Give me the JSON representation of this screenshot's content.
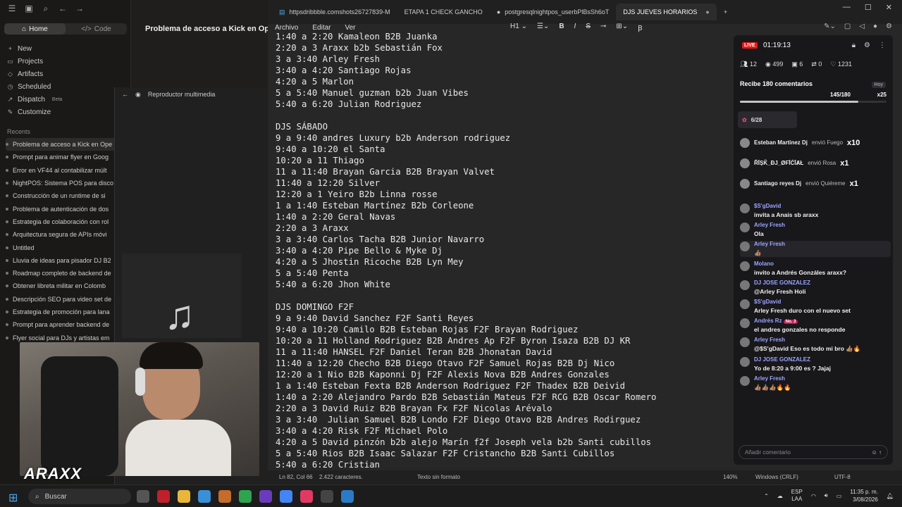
{
  "app_left": {
    "nav_tabs": [
      "Home",
      "Code"
    ],
    "nav": [
      "New",
      "Projects",
      "Artifacts",
      "Scheduled",
      "Dispatch",
      "Customize"
    ],
    "dispatch_badge": "Beta",
    "recents_title": "Recents",
    "recents": [
      "Problema de acceso a Kick en Ope",
      "Prompt para animar flyer en Goog",
      "Error en VF44 al contabilizar múlt",
      "NightPOS: Sistema POS para disco",
      "Construcción de un runtime de si",
      "Problema de autenticación de dos",
      "Estrategia de colaboración con rol",
      "Arquitectura segura de APIs móvi",
      "Untitled",
      "Lluvia de ideas para pisador DJ B2",
      "Roadmap completo de backend de",
      "Obtener libreta militar en Colomb",
      "Descripción SEO para video set de",
      "Estrategia de promoción para lana",
      "Prompt para aprender backend de",
      "Flyer social para DJs y artistas em"
    ],
    "chat_title": "Problema de acceso a Kick en Opera",
    "media_player_title": "Reproductor multimedia",
    "logo_text": "ARAXX"
  },
  "notepad": {
    "tabs": [
      "httpsdribbble.comshots26727839-M",
      "ETAPA 1 CHECK GANCHO",
      "postgresqlnightpos_userbPlBsSh6oT",
      "DJS JUEVES HORARIOS"
    ],
    "menu": [
      "Archivo",
      "Editar",
      "Ver"
    ],
    "heading_label": "H1",
    "content": "1:40 a 2:20 Kamaleon B2B Juanka\n2:20 a 3 Araxx b2b Sebastián Fox\n3 a 3:40 Arley Fresh\n3:40 a 4:20 Santiago Rojas\n4:20 a 5 Marlon\n5 a 5:40 Manuel guzman b2b Juan Vibes\n5:40 a 6:20 Julian Rodriguez\n\nDJS SÁBADO\n9 a 9:40 andres Luxury b2b Anderson rodriguez\n9:40 a 10:20 el Santa\n10:20 a 11 Thiago\n11 a 11:40 Brayan Garcia B2B Brayan Valvet\n11:40 a 12:20 Silver\n12:20 a 1 Yeiro B2b Linna rosse\n1 a 1:40 Esteban Martínez B2b Corleone\n1:40 a 2:20 Geral Navas\n2:20 a 3 Araxx\n3 a 3:40 Carlos Tacha B2B Junior Navarro\n3:40 a 4:20 Pipe Bello & Myke Dj\n4:20 a 5 Jhostin Ricoche B2B Lyn Mey\n5 a 5:40 Penta\n5:40 a 6:20 Jhon White\n\nDJS DOMINGO F2F\n9 a 9:40 David Sanchez F2F Santi Reyes\n9:40 a 10:20 Camilo B2B Esteban Rojas F2F Brayan Rodriguez\n10:20 a 11 Holland Rodriguez B2B Andres Ap F2F Byron Isaza B2B DJ KR\n11 a 11:40 HANSEL F2F Daniel Teran B2B Jhonatan David\n11:40 a 12:20 Checho B2B Diego Otavo F2F Samuel Rojas B2B Dj Nico\n12:20 a 1 Nio B2B Kaponni Dj F2F Alexis Nova B2B Andres Gonzales\n1 a 1:40 Esteban Fexta B2B Anderson Rodriguez F2F Thadex B2B Deivid\n1:40 a 2:20 Alejandro Pardo B2B Sebastián Mateus F2F RCG B2B Oscar Romero\n2:20 a 3 David Ruiz B2B Brayan Fx F2F Nicolas Arévalo\n3 a 3:40  Julian Samuel B2B Londo F2F Diego Otavo B2B Andres Rodirguez\n3:40 a 4:20 Risk F2F Michael Polo\n4:20 a 5 David pinzón b2b alejo Marín f2f Joseph vela b2b Santi cubillos\n5 a 5:40 Rios B2B Isaac Salazar F2F Cristancho B2B Santi Cubillos\n5:40 a 6:20 Cristian",
    "status": {
      "position": "Ln 82, Col 66",
      "chars": "2.422 caracteres.",
      "format": "Texto sin formato",
      "zoom": "140%",
      "eol": "Windows (CRLF)",
      "encoding": "UTF-8"
    }
  },
  "live_chat": {
    "live_label": "LIVE",
    "timer": "01:19:13",
    "stats": [
      "12",
      "499",
      "6",
      "0",
      "1231"
    ],
    "goal_title": "Recibe 180 comentarios",
    "goal_tag": "Hoy",
    "goal_progress": "145/180",
    "goal_reward": "x25",
    "goal_fraction": 0.806,
    "gift_counter": "6/28",
    "gifts": [
      {
        "user": "Esteban Martinez Dj",
        "text": "envió Fuego",
        "count": "x10"
      },
      {
        "user": "ŘĪȘǨ_ĐJ_ØFĪĊĪȺŁ",
        "text": "envió Rosa",
        "count": "x1"
      },
      {
        "user": "Santiago reyes Dj",
        "text": "envió Quiéreme",
        "count": "x1"
      }
    ],
    "messages": [
      {
        "user": "$S'gDavid",
        "text": "invita a Anais sb araxx"
      },
      {
        "user": "Arley Fresh",
        "text": "Ola"
      },
      {
        "user": "Arley Fresh",
        "text": "👍🏽"
      },
      {
        "user": "Molano",
        "text": "invito a Andrés Gonzáles araxx?"
      },
      {
        "user": "DJ JOSE GONZALEZ",
        "text": "@Arley Fresh Holi"
      },
      {
        "user": "$S'gDavid",
        "text": "Arley Fresh duro con el nuevo set"
      },
      {
        "user": "Andrés Rz",
        "text": "el andres gonzales no responde"
      },
      {
        "user": "Arley Fresh",
        "text": "@$S'gDavid Eso es todo mi bro 👍🏽🔥"
      },
      {
        "user": "DJ JOSE GONZALEZ",
        "text": "Yo de 8:20 a 9:00 es ? Jajaj"
      },
      {
        "user": "Arley Fresh",
        "text": "👍🏽👍🏽👍🏽🔥🔥"
      }
    ],
    "andres_badge": "No. 3",
    "input_placeholder": "Añadir comentario"
  },
  "taskbar": {
    "search_label": "Buscar",
    "lang": "ESP",
    "lang2": "LAA",
    "time": "11:35 p. m.",
    "date": "3/08/2026"
  }
}
